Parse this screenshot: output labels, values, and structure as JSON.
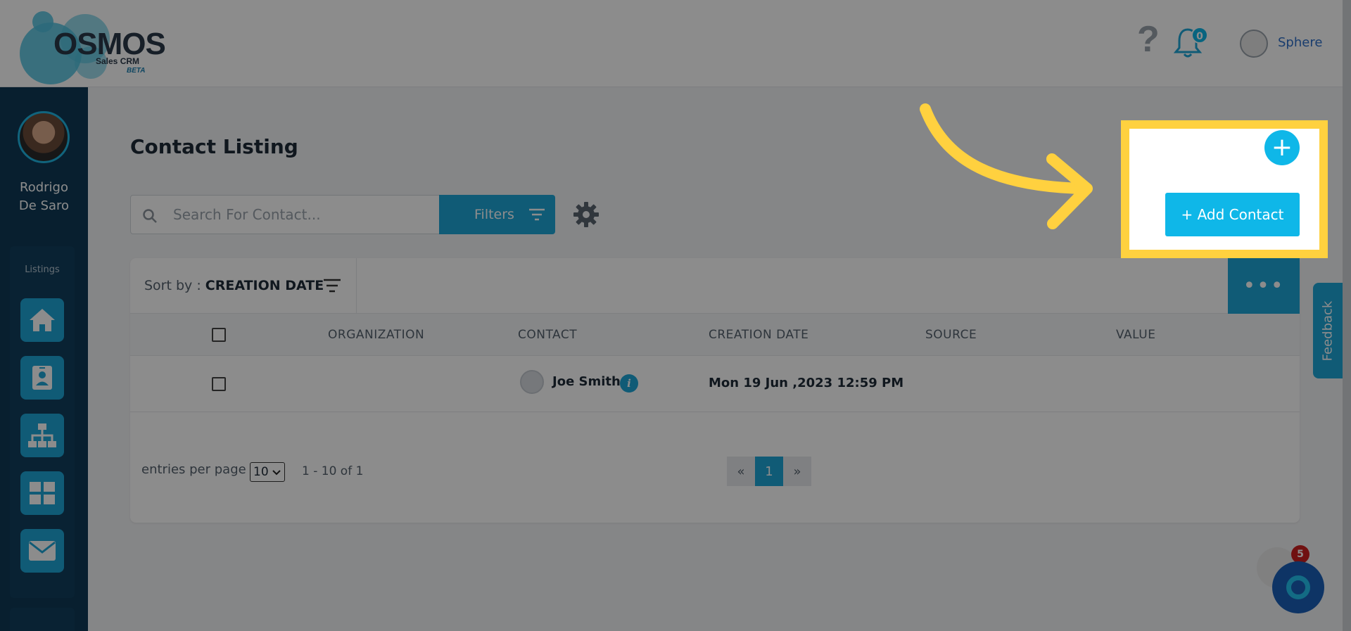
{
  "logo": {
    "name": "OSMOS",
    "sub": "Sales CRM",
    "beta": "BETA"
  },
  "header": {
    "help_glyph": "?",
    "notifications_count": "0",
    "user_name": "Sphere"
  },
  "sidebar": {
    "user_name": "Rodrigo De Saro",
    "section_label": "Listings",
    "items": [
      {
        "icon": "home-icon"
      },
      {
        "icon": "contact-card-icon"
      },
      {
        "icon": "hierarchy-icon"
      },
      {
        "icon": "grid-icon"
      },
      {
        "icon": "mail-icon"
      }
    ]
  },
  "page": {
    "title": "Contact Listing"
  },
  "search": {
    "placeholder": "Search For Contact..."
  },
  "filters": {
    "label": "Filters"
  },
  "sort": {
    "prefix": "Sort by : ",
    "value": "CREATION DATE"
  },
  "more_label": "•••",
  "table": {
    "columns": [
      "ORGANIZATION",
      "CONTACT",
      "CREATION DATE",
      "SOURCE",
      "VALUE"
    ],
    "rows": [
      {
        "organization": "",
        "contact": "Joe Smith",
        "creation_date": "Mon 19 Jun ,2023 12:59 PM",
        "source": "",
        "value": ""
      }
    ]
  },
  "pager": {
    "label": "entries per page",
    "per_page": "10",
    "range": "1 - 10 of 1",
    "prev": "«",
    "current": "1",
    "next": "»"
  },
  "highlight": {
    "plus": "+",
    "add_contact": "+ Add Contact"
  },
  "feedback": {
    "label": "Feedback"
  },
  "chat": {
    "badge": "5"
  },
  "colors": {
    "accent": "#1ea7d8",
    "highlight": "#ffd13f",
    "sidebar": "#0f3a56"
  }
}
